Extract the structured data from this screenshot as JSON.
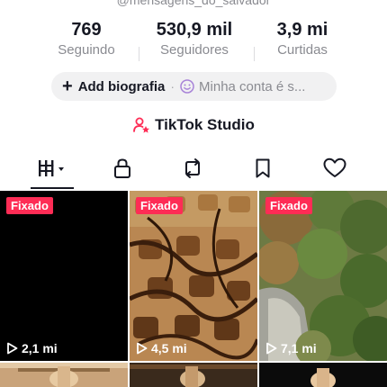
{
  "profile": {
    "username": "@mensagens_do_salvador"
  },
  "stats": {
    "following": {
      "value": "769",
      "label": "Seguindo"
    },
    "followers": {
      "value": "530,9 mil",
      "label": "Seguidores"
    },
    "likes": {
      "value": "3,9 mi",
      "label": "Curtidas"
    }
  },
  "bio": {
    "plus_icon": "plus-icon",
    "add_label": "Add biografia",
    "separator": "·",
    "account_icon": "smiley-icon",
    "account_label": "Minha conta é s..."
  },
  "studio": {
    "icon": "person-star-icon",
    "label": "TikTok Studio",
    "icon_color": "#fe2c55"
  },
  "tabs": [
    {
      "icon": "grid-videos-icon",
      "active": true
    },
    {
      "icon": "lock-icon",
      "active": false
    },
    {
      "icon": "repost-icon",
      "active": false
    },
    {
      "icon": "bookmark-icon",
      "active": false
    },
    {
      "icon": "heart-icon",
      "active": false
    }
  ],
  "videos": [
    {
      "pinned_label": "Fixado",
      "views": "2,1 mi",
      "thumb": "black"
    },
    {
      "pinned_label": "Fixado",
      "views": "4,5 mi",
      "thumb": "wafer-chocolate"
    },
    {
      "pinned_label": "Fixado",
      "views": "7,1 mi",
      "thumb": "mossy-rocks"
    },
    {
      "thumb": "crucifix-warm"
    },
    {
      "thumb": "crucifix-dark"
    },
    {
      "thumb": "crucifix-black"
    }
  ],
  "colors": {
    "accent": "#fe2c55",
    "text_primary": "#161823",
    "text_secondary": "#8a8b91"
  }
}
